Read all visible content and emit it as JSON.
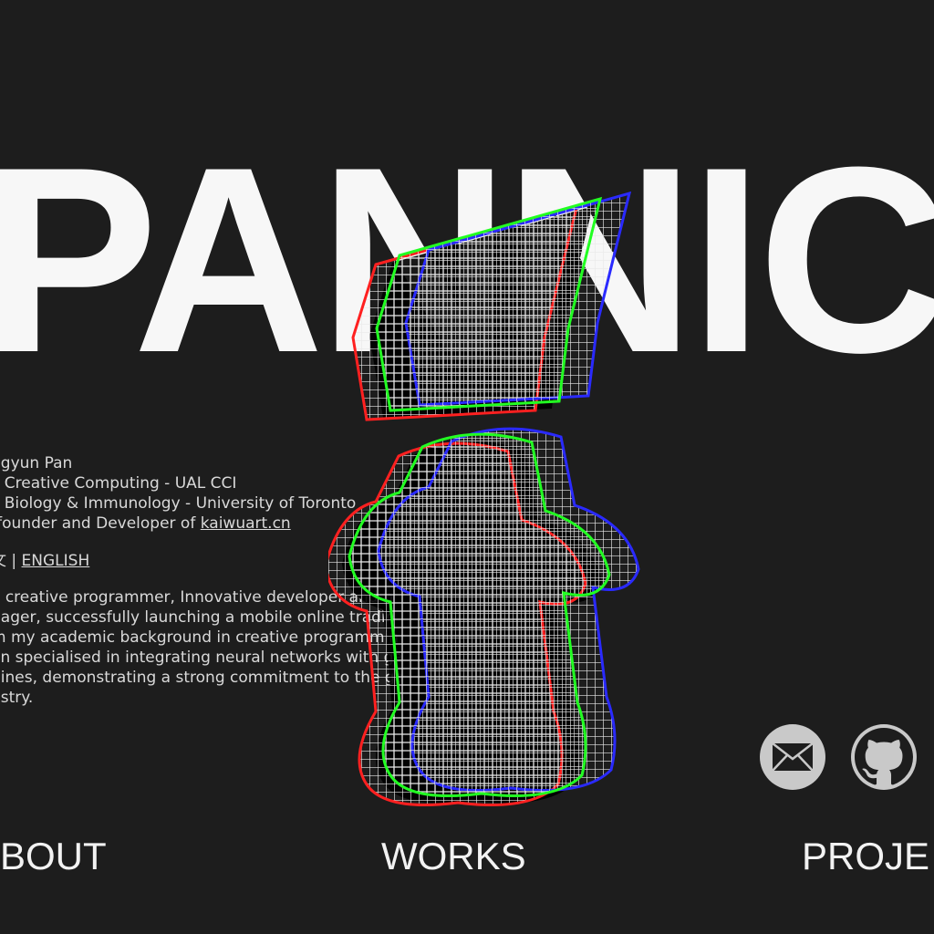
{
  "hero": {
    "title": "PANNIC"
  },
  "bio": {
    "lines": [
      "ngyun Pan",
      "c Creative Computing - UAL CCI",
      "c Biology & Immunology - University of Toronto",
      "-founder and Developer of "
    ],
    "link": "kaiwuart.cn",
    "lang_prefix": "文 | ",
    "lang_english": "ENGLISH"
  },
  "about": {
    "lines": [
      "a creative programmer, Innovative developer and p",
      "nager, successfully launching a mobile online tradin",
      "m my academic background in creative programmin",
      "en specialised in integrating neural networks with ga",
      "gines, demonstrating a strong commitment to the ga",
      "ustry."
    ]
  },
  "social": {
    "items": [
      {
        "icon": "mail-icon"
      },
      {
        "icon": "github-icon"
      }
    ]
  },
  "nav": {
    "about": "BOUT",
    "works": "WORKS",
    "projects": "PROJE"
  },
  "colors": {
    "background": "#1d1d1d",
    "glitch_red": "#ff2020",
    "glitch_green": "#22ff22",
    "glitch_blue": "#2a2aff"
  }
}
